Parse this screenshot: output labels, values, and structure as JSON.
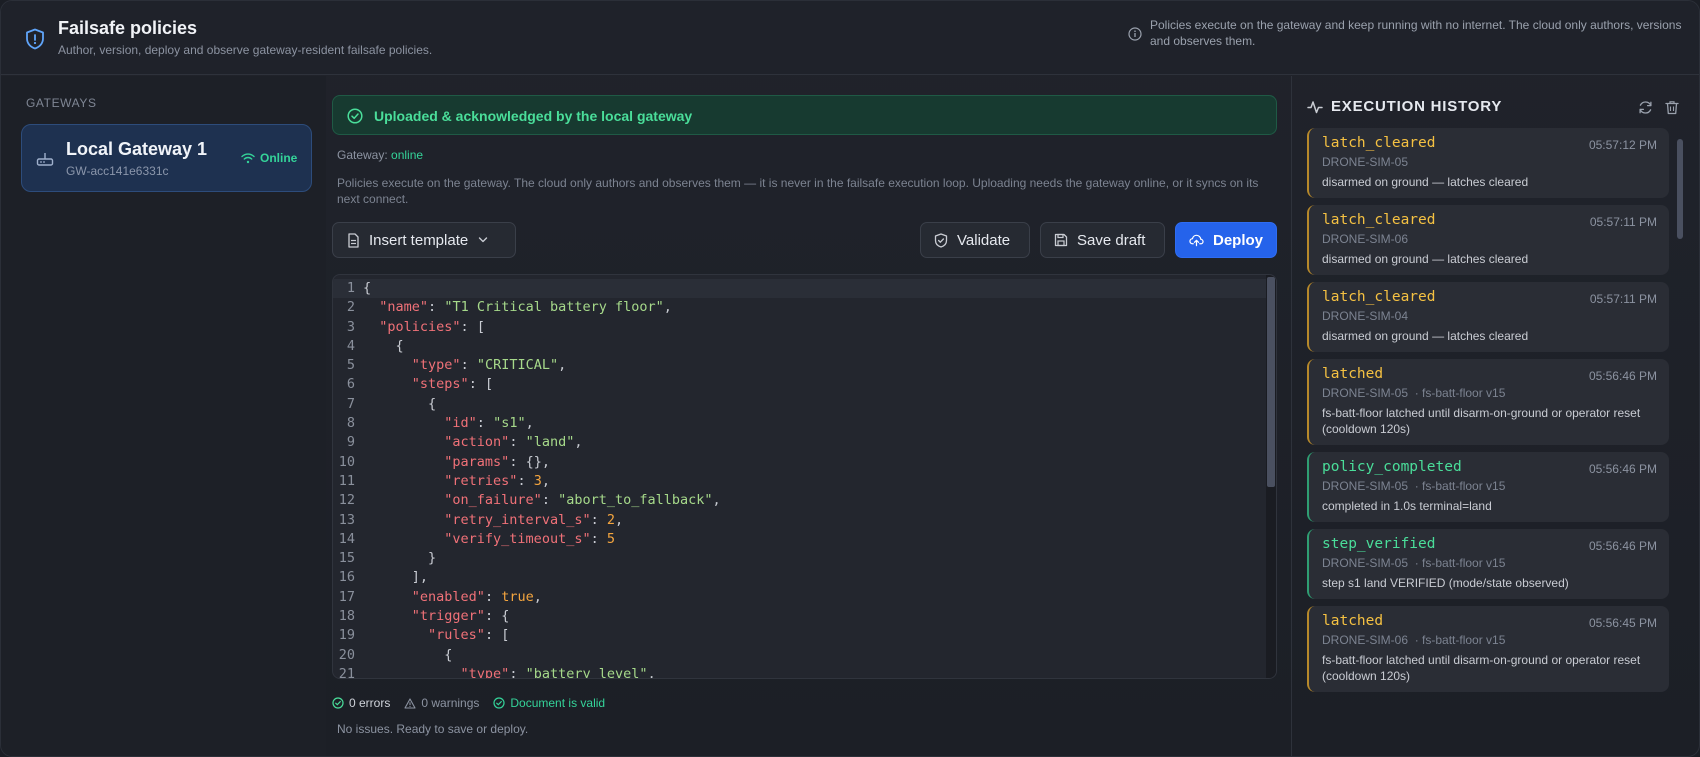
{
  "header": {
    "title": "Failsafe policies",
    "subtitle": "Author, version, deploy and observe gateway-resident failsafe policies.",
    "info": "Policies execute on the gateway and keep running with no internet. The cloud only authors, versions and observes them."
  },
  "sidebar": {
    "section_label": "GATEWAYS",
    "gateway": {
      "name": "Local Gateway 1",
      "id": "GW-acc141e6331c",
      "status": "Online"
    }
  },
  "main": {
    "banner": "Uploaded & acknowledged by the local gateway",
    "gateway_label": "Gateway:",
    "gateway_value": "online",
    "description": "Policies execute on the gateway. The cloud only authors and observes them — it is never in the failsafe execution loop. Uploading needs the gateway online, or it syncs on its next connect.",
    "buttons": {
      "template": "Insert template",
      "validate": "Validate",
      "save": "Save draft",
      "deploy": "Deploy"
    },
    "status": {
      "errors": "0 errors",
      "warnings": "0 warnings",
      "valid": "Document is valid",
      "summary": "No issues. Ready to save or deploy."
    }
  },
  "editor": {
    "lines": [
      "{",
      "  \"name\": \"T1 Critical battery floor\",",
      "  \"policies\": [",
      "    {",
      "      \"type\": \"CRITICAL\",",
      "      \"steps\": [",
      "        {",
      "          \"id\": \"s1\",",
      "          \"action\": \"land\",",
      "          \"params\": {},",
      "          \"retries\": 3,",
      "          \"on_failure\": \"abort_to_fallback\",",
      "          \"retry_interval_s\": 2,",
      "          \"verify_timeout_s\": 5",
      "        }",
      "      ],",
      "      \"enabled\": true,",
      "      \"trigger\": {",
      "        \"rules\": [",
      "          {",
      "            \"type\": \"battery_level\","
    ]
  },
  "history": {
    "title": "EXECUTION HISTORY",
    "events": [
      {
        "name": "latch_cleared",
        "time": "05:57:12 PM",
        "drone": "DRONE-SIM-05",
        "policy": "",
        "message": "disarmed on ground — latches cleared",
        "kind": "warn"
      },
      {
        "name": "latch_cleared",
        "time": "05:57:11 PM",
        "drone": "DRONE-SIM-06",
        "policy": "",
        "message": "disarmed on ground — latches cleared",
        "kind": "warn"
      },
      {
        "name": "latch_cleared",
        "time": "05:57:11 PM",
        "drone": "DRONE-SIM-04",
        "policy": "",
        "message": "disarmed on ground — latches cleared",
        "kind": "warn"
      },
      {
        "name": "latched",
        "time": "05:56:46 PM",
        "drone": "DRONE-SIM-05",
        "policy": "· fs-batt-floor v15",
        "message": "fs-batt-floor latched until disarm-on-ground or operator reset (cooldown 120s)",
        "kind": "warn"
      },
      {
        "name": "policy_completed",
        "time": "05:56:46 PM",
        "drone": "DRONE-SIM-05",
        "policy": "· fs-batt-floor v15",
        "message": "completed in 1.0s terminal=land",
        "kind": "ok"
      },
      {
        "name": "step_verified",
        "time": "05:56:46 PM",
        "drone": "DRONE-SIM-05",
        "policy": "· fs-batt-floor v15",
        "message": "step s1 land VERIFIED (mode/state observed)",
        "kind": "ok"
      },
      {
        "name": "latched",
        "time": "05:56:45 PM",
        "drone": "DRONE-SIM-06",
        "policy": "· fs-batt-floor v15",
        "message": "fs-batt-floor latched until disarm-on-ground or operator reset (cooldown 120s)",
        "kind": "warn"
      }
    ]
  }
}
